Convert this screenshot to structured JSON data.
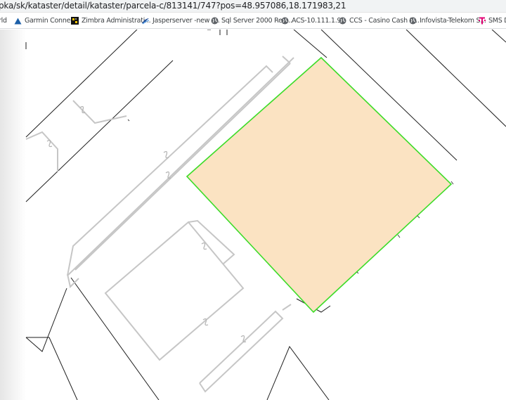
{
  "browser": {
    "url": "pka/sk/kataster/detail/kataster/parcela-c/813141/747?pos=48.957086,18.171983,21"
  },
  "bookmarks": [
    {
      "label": "rld",
      "icon": "none"
    },
    {
      "label": "Garmin Connect",
      "icon": "garmin-triangle-icon"
    },
    {
      "label": "Zimbra Administrati...",
      "icon": "zimbra-icon"
    },
    {
      "label": "Jasperserver -new -...",
      "icon": "jasper-icon"
    },
    {
      "label": "Sql Server 2000 Rep...",
      "icon": "globe-icon"
    },
    {
      "label": "ACS-10.111.1.99",
      "icon": "globe-icon"
    },
    {
      "label": "CCS - Casino Cash S...",
      "icon": "globe-icon"
    },
    {
      "label": "Infovista-Telekom S...",
      "icon": "globe-icon"
    },
    {
      "label": "SMS Di",
      "icon": "telekom-icon"
    }
  ],
  "map": {
    "selected_parcel_fill": "#fbe3c2",
    "selected_parcel_border": "#3cdc28",
    "building_line_color": "#c6c6c6",
    "boundary_line_color": "#1e1e1e"
  }
}
